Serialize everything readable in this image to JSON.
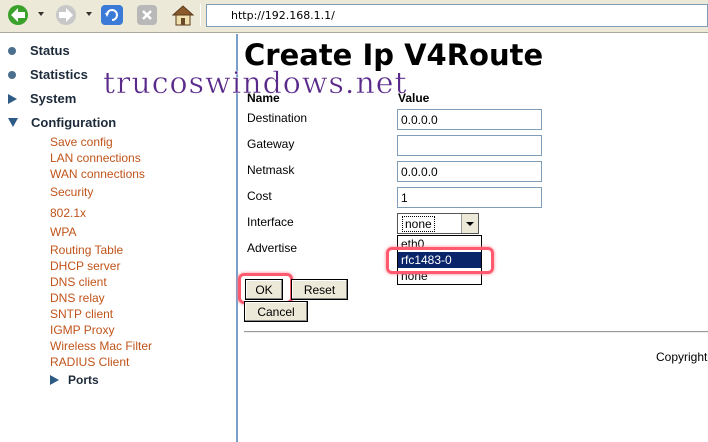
{
  "browser": {
    "address": "http://192.168.1.1/"
  },
  "sidebar": {
    "main_items": [
      {
        "label": "Status",
        "icon": "bullet-icon"
      },
      {
        "label": "Statistics",
        "icon": "bullet-icon"
      },
      {
        "label": "System",
        "icon": "triangle-right-icon"
      },
      {
        "label": "Configuration",
        "icon": "triangle-down-icon"
      }
    ],
    "sub_items": [
      "Save config",
      "LAN connections",
      "WAN connections",
      "Security",
      "802.1x",
      "WPA",
      "Routing Table",
      "DHCP server",
      "DNS client",
      "DNS relay",
      "SNTP client",
      "IGMP Proxy",
      "Wireless Mac Filter",
      "RADIUS Client"
    ],
    "ports": "Ports"
  },
  "watermark": "trucoswindows.net",
  "form": {
    "title": "Create Ip V4Route",
    "col_name": "Name",
    "col_value": "Value",
    "destination_label": "Destination",
    "destination_value": "0.0.0.0",
    "gateway_label": "Gateway",
    "gateway_value": "",
    "netmask_label": "Netmask",
    "netmask_value": "0.0.0.0",
    "cost_label": "Cost",
    "cost_value": "1",
    "interface_label": "Interface",
    "interface_value": "none",
    "interface_options": [
      "eth0",
      "rfc1483-0",
      "none"
    ],
    "interface_highlighted": "rfc1483-0",
    "advertise_label": "Advertise",
    "ok_label": "OK",
    "reset_label": "Reset",
    "cancel_label": "Cancel"
  },
  "footer": {
    "copyright": "Copyright"
  },
  "colors": {
    "accent_link": "#c0541a",
    "highlight": "#ff5a6e",
    "selection": "#0a246a",
    "watermark": "#5a2a8a"
  }
}
